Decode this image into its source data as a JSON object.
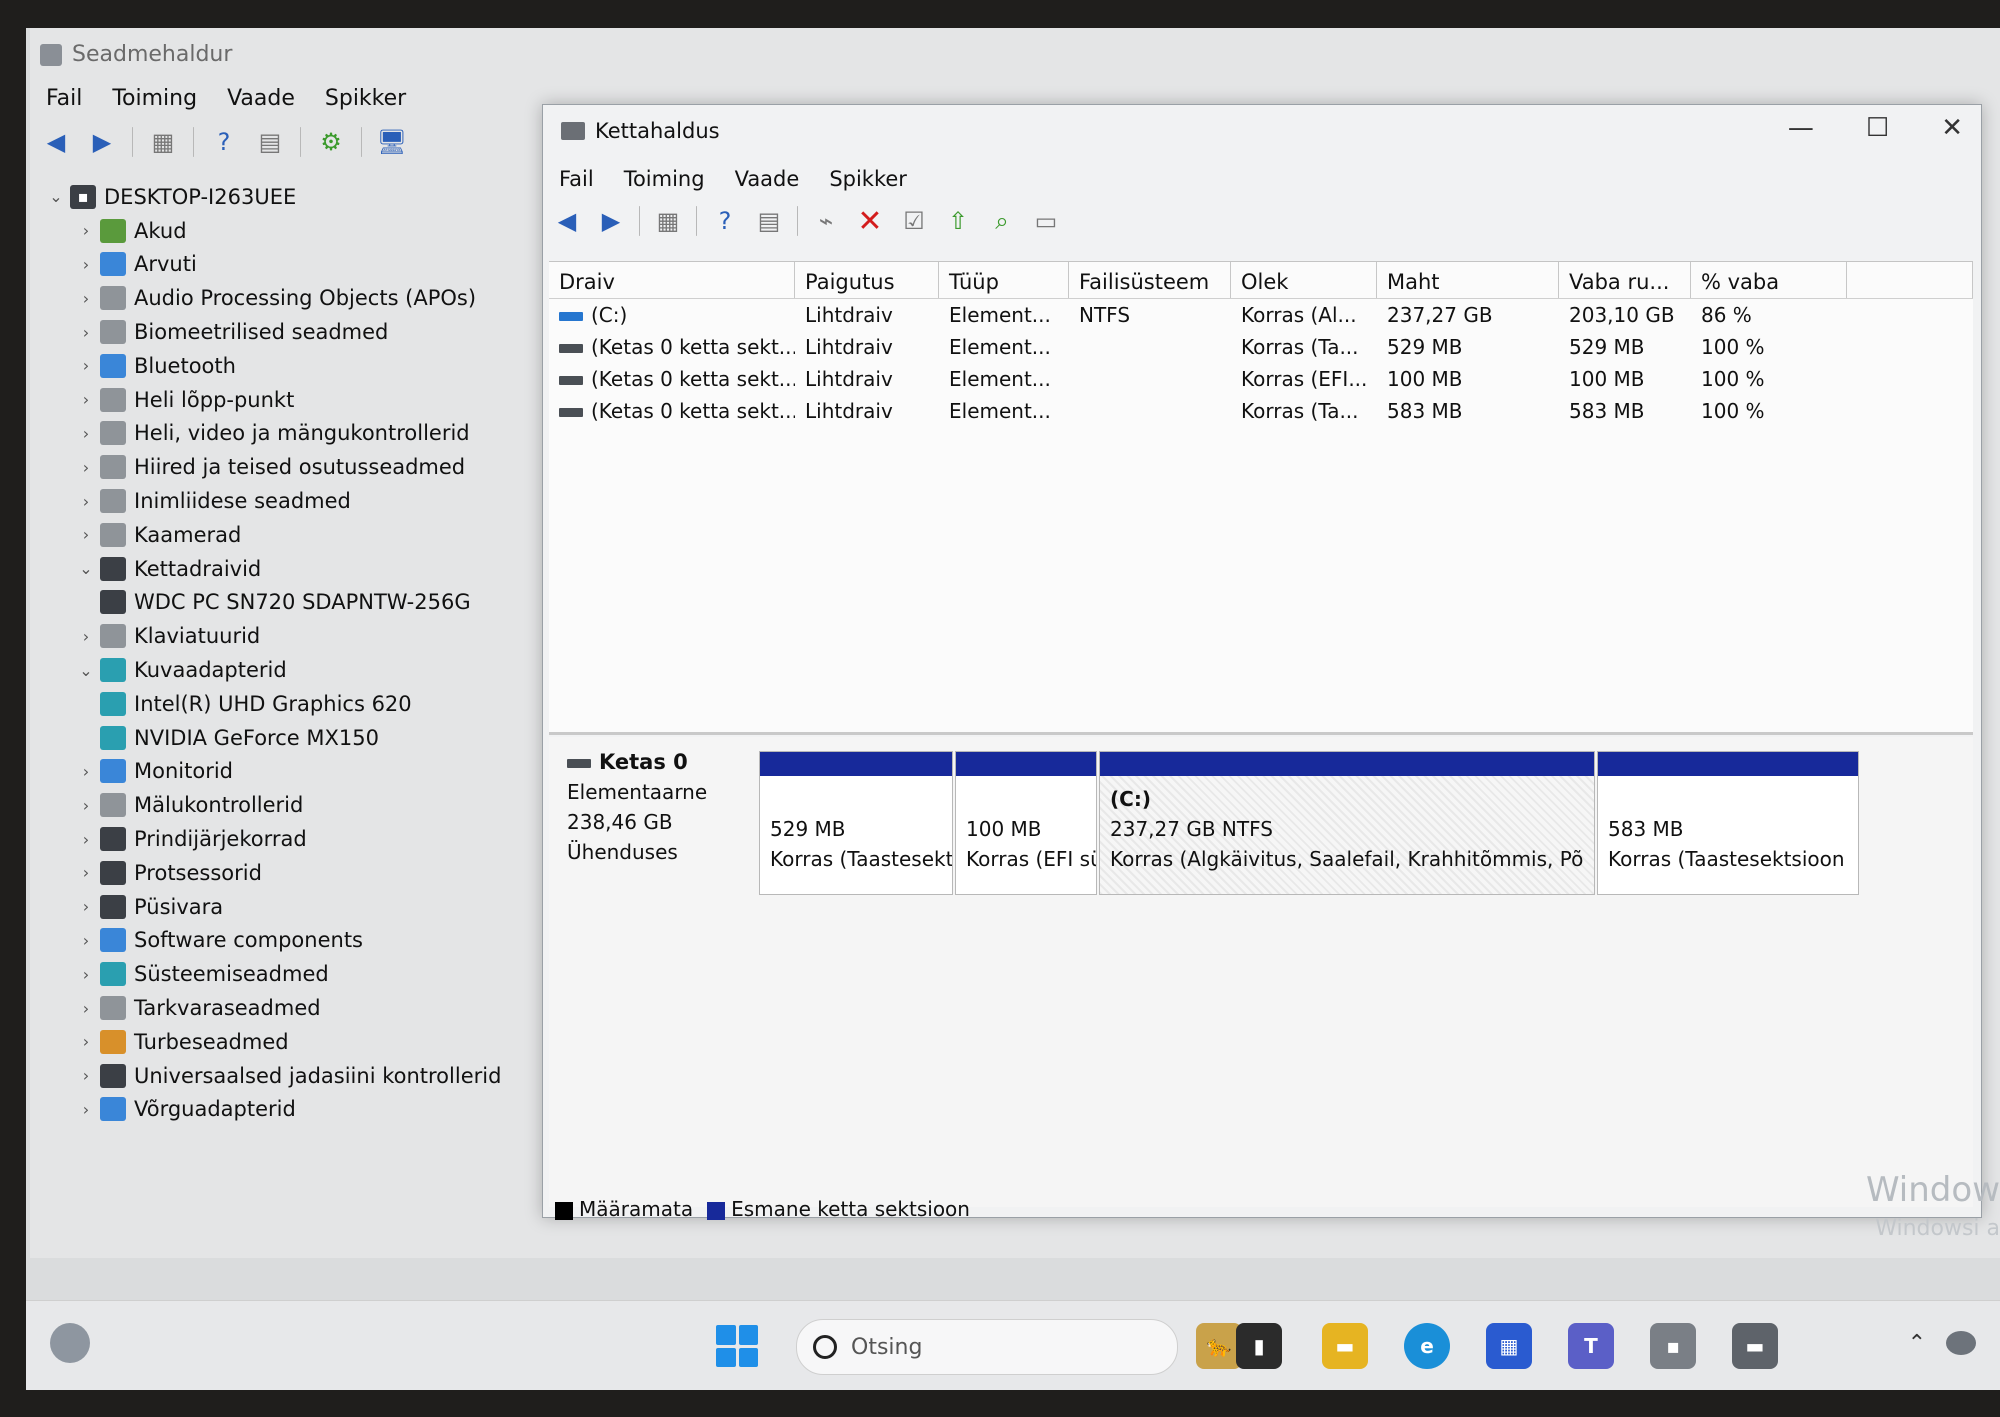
{
  "device_manager": {
    "title": "Seadmehaldur",
    "menu": [
      "Fail",
      "Toiming",
      "Vaade",
      "Spikker"
    ],
    "root": "DESKTOP-I263UEE",
    "tree": [
      {
        "label": "Akud",
        "expanded": false,
        "child": false
      },
      {
        "label": "Arvuti",
        "expanded": false,
        "child": false
      },
      {
        "label": "Audio Processing Objects (APOs)",
        "expanded": false,
        "child": false
      },
      {
        "label": "Biomeetrilised seadmed",
        "expanded": false,
        "child": false
      },
      {
        "label": "Bluetooth",
        "expanded": false,
        "child": false
      },
      {
        "label": "Heli lõpp-punkt",
        "expanded": false,
        "child": false
      },
      {
        "label": "Heli, video ja mängukontrollerid",
        "expanded": false,
        "child": false
      },
      {
        "label": "Hiired ja teised osutusseadmed",
        "expanded": false,
        "child": false
      },
      {
        "label": "Inimliidese seadmed",
        "expanded": false,
        "child": false
      },
      {
        "label": "Kaamerad",
        "expanded": false,
        "child": false
      },
      {
        "label": "Kettadraivid",
        "expanded": true,
        "child": false
      },
      {
        "label": "WDC PC SN720 SDAPNTW-256G",
        "expanded": false,
        "child": true
      },
      {
        "label": "Klaviatuurid",
        "expanded": false,
        "child": false
      },
      {
        "label": "Kuvaadapterid",
        "expanded": true,
        "child": false
      },
      {
        "label": "Intel(R) UHD Graphics 620",
        "expanded": false,
        "child": true
      },
      {
        "label": "NVIDIA GeForce MX150",
        "expanded": false,
        "child": true
      },
      {
        "label": "Monitorid",
        "expanded": false,
        "child": false
      },
      {
        "label": "Mälukontrollerid",
        "expanded": false,
        "child": false
      },
      {
        "label": "Prindijärjekorrad",
        "expanded": false,
        "child": false
      },
      {
        "label": "Protsessorid",
        "expanded": false,
        "child": false
      },
      {
        "label": "Püsivara",
        "expanded": false,
        "child": false
      },
      {
        "label": "Software components",
        "expanded": false,
        "child": false
      },
      {
        "label": "Süsteemiseadmed",
        "expanded": false,
        "child": false
      },
      {
        "label": "Tarkvaraseadmed",
        "expanded": false,
        "child": false
      },
      {
        "label": "Turbeseadmed",
        "expanded": false,
        "child": false
      },
      {
        "label": "Universaalsed jadasiini kontrollerid",
        "expanded": false,
        "child": false
      },
      {
        "label": "Võrguadapterid",
        "expanded": false,
        "child": false
      }
    ]
  },
  "disk_management": {
    "title": "Kettahaldus",
    "menu": [
      "Fail",
      "Toiming",
      "Vaade",
      "Spikker"
    ],
    "columns": [
      "Draiv",
      "Paigutus",
      "Tüüp",
      "Failisüsteem",
      "Olek",
      "Maht",
      "Vaba ru...",
      "% vaba"
    ],
    "rows": [
      [
        "(C:)",
        "Lihtdraiv",
        "Element...",
        "NTFS",
        "Korras (Al...",
        "237,27 GB",
        "203,10 GB",
        "86 %"
      ],
      [
        "(Ketas 0 ketta sekt...",
        "Lihtdraiv",
        "Element...",
        "",
        "Korras (Ta...",
        "529 MB",
        "529 MB",
        "100 %"
      ],
      [
        "(Ketas 0 ketta sekt...",
        "Lihtdraiv",
        "Element...",
        "",
        "Korras (EFI...",
        "100 MB",
        "100 MB",
        "100 %"
      ],
      [
        "(Ketas 0 ketta sekt...",
        "Lihtdraiv",
        "Element...",
        "",
        "Korras (Ta...",
        "583 MB",
        "583 MB",
        "100 %"
      ]
    ],
    "disk": {
      "name": "Ketas 0",
      "type": "Elementaarne",
      "size": "238,46 GB",
      "status": "Ühenduses"
    },
    "partitions": [
      {
        "name": "",
        "size": "529 MB",
        "status": "Korras (Taastesektsioo"
      },
      {
        "name": "",
        "size": "100 MB",
        "status": "Korras (EFI süst"
      },
      {
        "name": "(C:)",
        "size": "237,27 GB NTFS",
        "status": "Korras (Algkäivitus, Saalefail, Krahhitõmmis, Põ"
      },
      {
        "name": "",
        "size": "583 MB",
        "status": "Korras (Taastesektsioon"
      }
    ],
    "legend": [
      {
        "label": "Määramata",
        "color": "#000000"
      },
      {
        "label": "Esmane ketta sektsioon",
        "color": "#17299a"
      }
    ]
  },
  "taskbar": {
    "search_placeholder": "Otsing"
  },
  "watermark": {
    "line1": "Window",
    "line2": "Windowsi a"
  }
}
